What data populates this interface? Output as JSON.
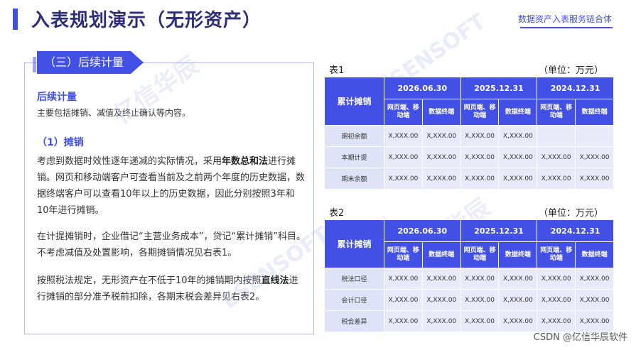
{
  "header": {
    "title": "入表规划演示（无形资产）",
    "brand": "数据资产入表服务链合体"
  },
  "left": {
    "tab": "（三）后续计量",
    "subhead": "后续计量",
    "intro": "主要包括摊销、减值及终止确认等内容。",
    "subhead2": "（1）摊销",
    "p1_a": "考虑到数据时效性逐年递减的实际情况，采用",
    "p1_b": "年数总和法",
    "p1_c": "进行摊销。网页和移动端客户可查看当前及之前两个年度的历史数据，数据终端客户可以查看10年以上的历史数据，因此分别按照3年和10年进行摊销。",
    "p2": "在计提摊销时，企业借记“主营业务成本”，贷记“累计摊销”科目。不考虑减值及处置影响，各期摊销情况见右表1。",
    "p3_a": "按照税法规定，无形资产在不低于10年的摊销期内按照",
    "p3_b": "直线法",
    "p3_c": "进行摊销的部分准予税前扣除，各期末税会差异见右表2。"
  },
  "watermark": {
    "text1": "亿信华辰",
    "text2": "ESENSOFT"
  },
  "table1": {
    "label": "表1",
    "unit": "（单位：万元）",
    "corner": "累计摊销",
    "dates": [
      "2026.06.30",
      "2025.12.31",
      "2024.12.31"
    ],
    "sub_a": "网页端、移动端",
    "sub_b": "数据终端",
    "rows": [
      {
        "name": "期初余额",
        "cells": [
          "X,XXX.00",
          "X,XXX.00",
          "X,XXX.00",
          "X,XXX.00",
          "",
          ""
        ]
      },
      {
        "name": "本期计提",
        "cells": [
          "X,XXX.00",
          "X,XXX.00",
          "X,XXX.00",
          "X,XXX.00",
          "X,XXX.00",
          "X,XXX.00"
        ]
      },
      {
        "name": "期末余额",
        "cells": [
          "X,XXX.00",
          "X,XXX.00",
          "X,XXX.00",
          "X,XXX.00",
          "X,XXX.00",
          "X,XXX.00"
        ]
      }
    ]
  },
  "table2": {
    "label": "表2",
    "unit": "（单位：万元）",
    "corner": "累计摊销",
    "dates": [
      "2026.06.30",
      "2025.12.31",
      "2024.12.31"
    ],
    "sub_a": "网页端、移动端",
    "sub_b": "数据终端",
    "rows": [
      {
        "name": "税法口径",
        "cells": [
          "X,XXX.00",
          "X,XXX.00",
          "X,XXX.00",
          "X,XXX.00",
          "X,XXX.00",
          "X,XXX.00"
        ]
      },
      {
        "name": "会计口径",
        "cells": [
          "X,XXX.00",
          "X,XXX.00",
          "X,XXX.00",
          "X,XXX.00",
          "X,XXX.00",
          "X,XXX.00"
        ]
      },
      {
        "name": "税会差异",
        "cells": [
          "X,XXX.00",
          "X,XXX.00",
          "X,XXX.00",
          "X,XXX.00",
          "X,XXX.00",
          "X,XXX.00"
        ]
      }
    ]
  },
  "footer": {
    "credit": "CSDN @亿信华辰软件"
  }
}
